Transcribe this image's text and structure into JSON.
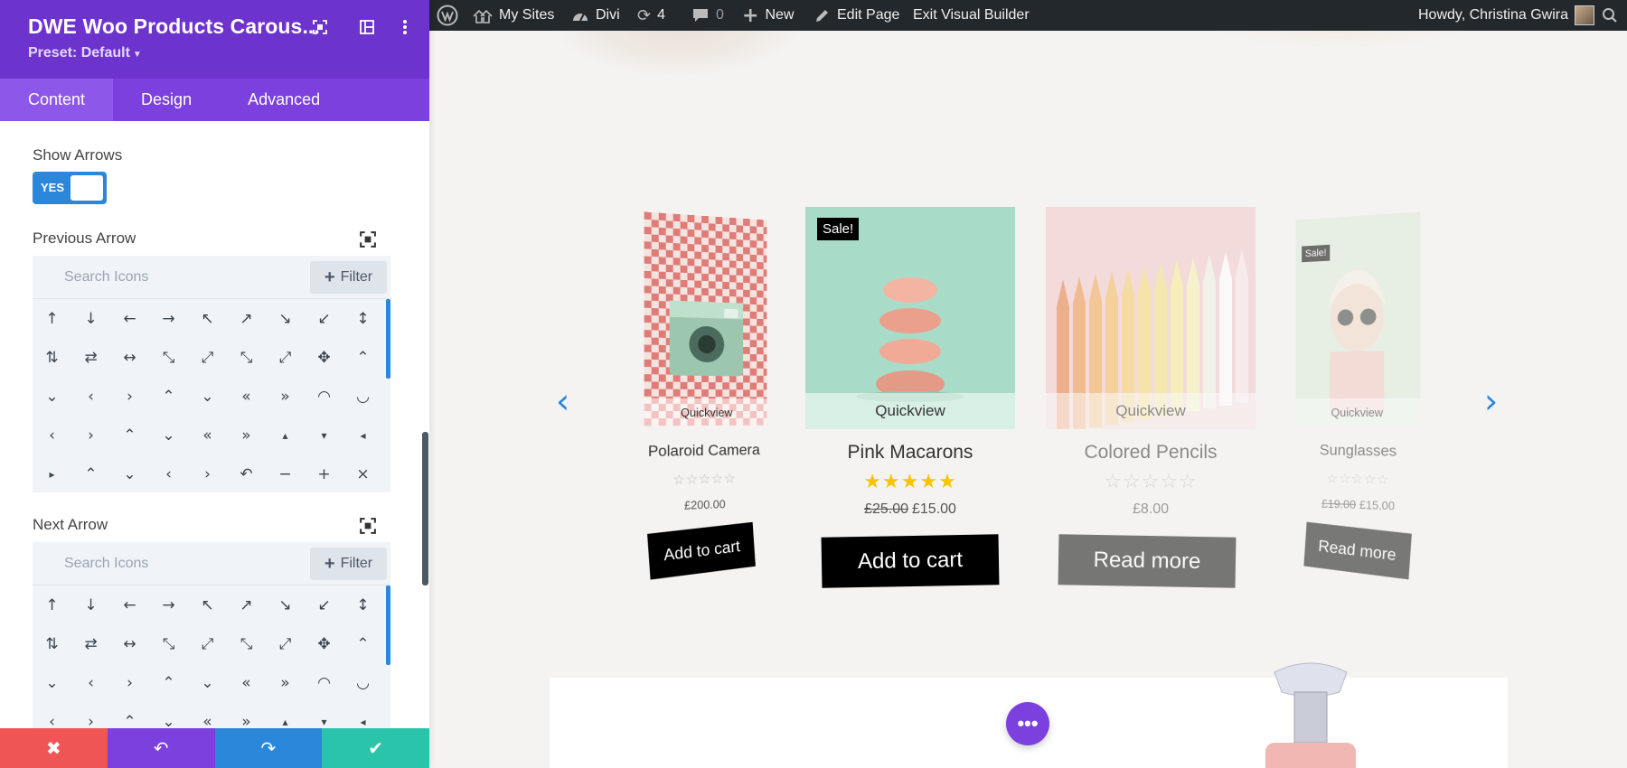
{
  "panel": {
    "title": "DWE Woo Products Carous...",
    "preset": "Preset: Default",
    "tabs": [
      {
        "label": "Content",
        "active": true
      },
      {
        "label": "Design",
        "active": false
      },
      {
        "label": "Advanced",
        "active": false
      }
    ],
    "show_arrows": {
      "label": "Show Arrows",
      "toggle": "YES"
    },
    "previous_arrow": {
      "label": "Previous Arrow",
      "search_placeholder": "Search Icons",
      "filter_label": "Filter"
    },
    "next_arrow": {
      "label": "Next Arrow",
      "search_placeholder": "Search Icons",
      "filter_label": "Filter"
    },
    "icon_set": [
      "↑",
      "↓",
      "←",
      "→",
      "↖",
      "↗",
      "↘",
      "↙",
      "↕",
      "⇅",
      "⇄",
      "↔",
      "⤡",
      "⤢",
      "⤡",
      "⤢",
      "✥",
      "⌃",
      "⌄",
      "‹",
      "›",
      "⌃",
      "⌄",
      "«",
      "»",
      "◠",
      "◡",
      "‹",
      "›",
      "⌃",
      "⌄",
      "«",
      "»",
      "▴",
      "▾",
      "◂",
      "▸",
      "⌃",
      "⌄",
      "‹",
      "›",
      "↶",
      "−",
      "+",
      "×"
    ],
    "footer": {
      "cancel": "✖",
      "undo": "↶",
      "redo": "↷",
      "save": "✔"
    }
  },
  "adminbar": {
    "my_sites": "My Sites",
    "divi": "Divi",
    "updates_count": "4",
    "comments_count": "0",
    "new": "New",
    "edit_page": "Edit Page",
    "exit_builder": "Exit Visual Builder",
    "howdy": "Howdy, Christina Gwira"
  },
  "products": [
    {
      "name": "Polaroid Camera",
      "price": "£200.00",
      "old_price": "",
      "button": "Add to cart",
      "sale": "",
      "quickview": "Quickview",
      "rating": 0
    },
    {
      "name": "Pink Macarons",
      "price": "£15.00",
      "old_price": "£25.00",
      "button": "Add to cart",
      "sale": "Sale!",
      "quickview": "Quickview",
      "rating": 5
    },
    {
      "name": "Colored Pencils",
      "price": "£8.00",
      "old_price": "",
      "button": "Read more",
      "sale": "",
      "quickview": "Quickview",
      "rating": 0
    },
    {
      "name": "Sunglasses",
      "price": "£15.00",
      "old_price": "£19.00",
      "button": "Read more",
      "sale": "Sale!",
      "quickview": "Quickview",
      "rating": 0
    }
  ],
  "colors": {
    "panel_purple": "#6d33cd",
    "tab_purple": "#7b40dd",
    "accent_blue": "#2b87da",
    "cancel_red": "#ef5555",
    "save_green": "#29c4a9",
    "star_gold": "#f6c500"
  },
  "fab_icon": "•••"
}
